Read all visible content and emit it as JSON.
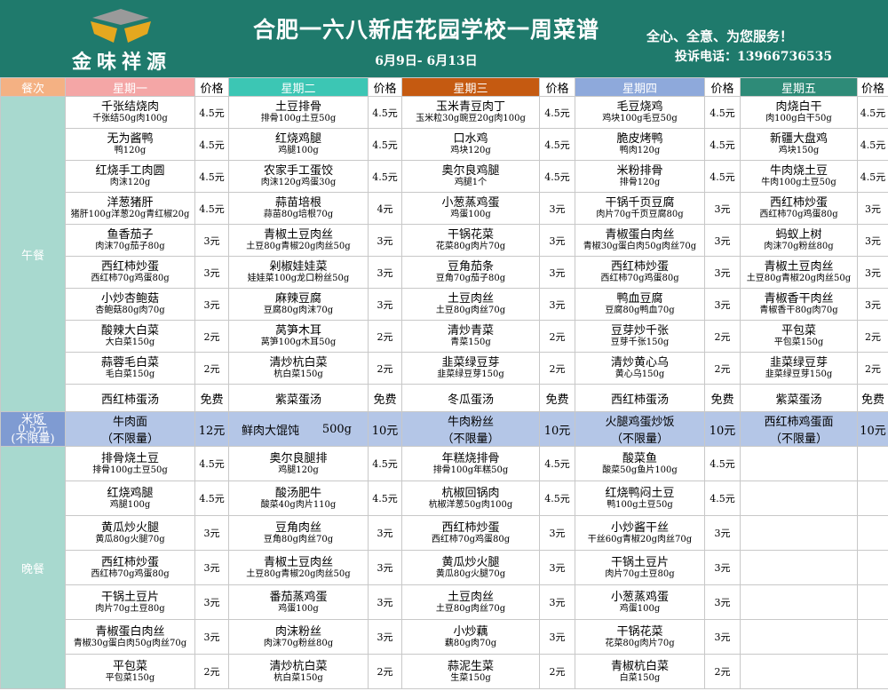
{
  "brand": {
    "name": "金味祥源"
  },
  "title": "合肥一六八新店花园学校一周菜谱",
  "date_range": "6月9日- 6月13日",
  "slogan": "全心、全意、为您服务！",
  "hotline": "投诉电话：13966736535",
  "colors": {
    "header_bg": "#1f7a6c",
    "logo_gold": "#e5a81f",
    "logo_grey": "#9a9a9a"
  },
  "columns": {
    "meal": "餐次",
    "price": "价格",
    "days": [
      "星期一",
      "星期二",
      "星期三",
      "星期四",
      "星期五"
    ]
  },
  "meals": {
    "lunch": "午餐",
    "rice": "米饭\n0.5元\n(不限量)",
    "dinner": "晚餐"
  },
  "lunch_rows": [
    [
      {
        "n": "千张结烧肉",
        "d": "千张结50g肉100g",
        "p": "4.5元"
      },
      {
        "n": "土豆排骨",
        "d": "排骨100g土豆50g",
        "p": "4.5元"
      },
      {
        "n": "玉米青豆肉丁",
        "d": "玉米粒30g豌豆20g肉100g",
        "p": "4.5元"
      },
      {
        "n": "毛豆烧鸡",
        "d": "鸡块100g毛豆50g",
        "p": "4.5元"
      },
      {
        "n": "肉烧白干",
        "d": "肉100g白干50g",
        "p": "4.5元"
      }
    ],
    [
      {
        "n": "无为酱鸭",
        "d": "鸭120g",
        "p": "4.5元"
      },
      {
        "n": "红烧鸡腿",
        "d": "鸡腿100g",
        "p": "4.5元"
      },
      {
        "n": "口水鸡",
        "d": "鸡块120g",
        "p": "4.5元"
      },
      {
        "n": "脆皮烤鸭",
        "d": "鸭肉120g",
        "p": "4.5元"
      },
      {
        "n": "新疆大盘鸡",
        "d": "鸡块150g",
        "p": "4.5元"
      }
    ],
    [
      {
        "n": "红烧手工肉圆",
        "d": "肉沫120g",
        "p": "4.5元"
      },
      {
        "n": "农家手工蛋饺",
        "d": "肉沫120g鸡蛋30g",
        "p": "4.5元"
      },
      {
        "n": "奥尔良鸡腿",
        "d": "鸡腿1个",
        "p": "4.5元"
      },
      {
        "n": "米粉排骨",
        "d": "排骨120g",
        "p": "4.5元"
      },
      {
        "n": "牛肉烧土豆",
        "d": "牛肉100g土豆50g",
        "p": "4.5元"
      }
    ],
    [
      {
        "n": "洋葱猪肝",
        "d": "猪肝100g洋葱20g青红椒20g",
        "p": "4.5元"
      },
      {
        "n": "蒜苗培根",
        "d": "蒜苗80g培根70g",
        "p": "4元"
      },
      {
        "n": "小葱蒸鸡蛋",
        "d": "鸡蛋100g",
        "p": "3元"
      },
      {
        "n": "干锅千页豆腐",
        "d": "肉片70g千页豆腐80g",
        "p": "3元"
      },
      {
        "n": "西红柿炒蛋",
        "d": "西红柿70g鸡蛋80g",
        "p": "3元"
      }
    ],
    [
      {
        "n": "鱼香茄子",
        "d": "肉沫70g茄子80g",
        "p": "3元"
      },
      {
        "n": "青椒土豆肉丝",
        "d": "土豆80g青椒20g肉丝50g",
        "p": "3元"
      },
      {
        "n": "干锅花菜",
        "d": "花菜80g肉片70g",
        "p": "3元"
      },
      {
        "n": "青椒蛋白肉丝",
        "d": "青椒30g蛋白肉50g肉丝70g",
        "p": "3元"
      },
      {
        "n": "蚂蚁上树",
        "d": "肉沫70g粉丝80g",
        "p": "3元"
      }
    ],
    [
      {
        "n": "西红柿炒蛋",
        "d": "西红柿70g鸡蛋80g",
        "p": "3元"
      },
      {
        "n": "剁椒娃娃菜",
        "d": "娃娃菜100g龙口粉丝50g",
        "p": "3元"
      },
      {
        "n": "豆角茄条",
        "d": "豆角70g茄子80g",
        "p": "3元"
      },
      {
        "n": "西红柿炒蛋",
        "d": "西红柿70g鸡蛋80g",
        "p": "3元"
      },
      {
        "n": "青椒土豆肉丝",
        "d": "土豆80g青椒20g肉丝50g",
        "p": "3元"
      }
    ],
    [
      {
        "n": "小炒杏鲍菇",
        "d": "杏鲍菇80g肉70g",
        "p": "3元"
      },
      {
        "n": "麻辣豆腐",
        "d": "豆腐80g肉沫70g",
        "p": "3元"
      },
      {
        "n": "土豆肉丝",
        "d": "土豆80g肉丝70g",
        "p": "3元"
      },
      {
        "n": "鸭血豆腐",
        "d": "豆腐80g鸭血70g",
        "p": "3元"
      },
      {
        "n": "青椒香干肉丝",
        "d": "青椒香干80g肉70g",
        "p": "3元"
      }
    ],
    [
      {
        "n": "酸辣大白菜",
        "d": "大白菜150g",
        "p": "2元"
      },
      {
        "n": "莴笋木耳",
        "d": "莴笋100g木耳50g",
        "p": "2元"
      },
      {
        "n": "清炒青菜",
        "d": "青菜150g",
        "p": "2元"
      },
      {
        "n": "豆芽炒千张",
        "d": "豆芽千张150g",
        "p": "2元"
      },
      {
        "n": "平包菜",
        "d": "平包菜150g",
        "p": "2元"
      }
    ],
    [
      {
        "n": "蒜蓉毛白菜",
        "d": "毛白菜150g",
        "p": "2元"
      },
      {
        "n": "清炒杭白菜",
        "d": "杭白菜150g",
        "p": "2元"
      },
      {
        "n": "韭菜绿豆芽",
        "d": "韭菜绿豆芽150g",
        "p": "2元"
      },
      {
        "n": "清炒黄心乌",
        "d": "黄心乌150g",
        "p": "2元"
      },
      {
        "n": "韭菜绿豆芽",
        "d": "韭菜绿豆芽150g",
        "p": "2元"
      }
    ]
  ],
  "soup_row": [
    {
      "n": "西红柿蛋汤",
      "p": "免费"
    },
    {
      "n": "紫菜蛋汤",
      "p": "免费"
    },
    {
      "n": "冬瓜蛋汤",
      "p": "免费"
    },
    {
      "n": "西红柿蛋汤",
      "p": "免费"
    },
    {
      "n": "紫菜蛋汤",
      "p": "免费"
    }
  ],
  "rice_row": [
    {
      "n": "牛肉面",
      "sub": "（不限量）",
      "p": "12元"
    },
    {
      "n": "鲜肉大馄饨",
      "extra": "500g",
      "p": "10元"
    },
    {
      "n": "牛肉粉丝",
      "sub": "（不限量）",
      "p": "10元"
    },
    {
      "n": "火腿鸡蛋炒饭",
      "sub": "（不限量）",
      "p": "10元"
    },
    {
      "n": "西红柿鸡蛋面",
      "sub": "（不限量）",
      "p": "10元"
    }
  ],
  "dinner_rows": [
    [
      {
        "n": "排骨烧土豆",
        "d": "排骨100g土豆50g",
        "p": "4.5元"
      },
      {
        "n": "奥尔良腿排",
        "d": "鸡腿120g",
        "p": "4.5元"
      },
      {
        "n": "年糕烧排骨",
        "d": "排骨100g年糕50g",
        "p": "4.5元"
      },
      {
        "n": "酸菜鱼",
        "d": "酸菜50g鱼片100g",
        "p": "4.5元"
      }
    ],
    [
      {
        "n": "红烧鸡腿",
        "d": "鸡腿100g",
        "p": "4.5元"
      },
      {
        "n": "酸汤肥牛",
        "d": "酸菜40g肉片110g",
        "p": "4.5元"
      },
      {
        "n": "杭椒回锅肉",
        "d": "杭椒洋葱50g肉100g",
        "p": "4.5元"
      },
      {
        "n": "红烧鸭闷土豆",
        "d": "鸭100g土豆50g",
        "p": "4.5元"
      }
    ],
    [
      {
        "n": "黄瓜炒火腿",
        "d": "黄瓜80g火腿70g",
        "p": "3元"
      },
      {
        "n": "豆角肉丝",
        "d": "豆角80g肉丝70g",
        "p": "3元"
      },
      {
        "n": "西红柿炒蛋",
        "d": "西红柿70g鸡蛋80g",
        "p": "3元"
      },
      {
        "n": "小炒酱干丝",
        "d": "干丝60g青椒20g肉丝70g",
        "p": "3元"
      }
    ],
    [
      {
        "n": "西红柿炒蛋",
        "d": "西红柿70g鸡蛋80g",
        "p": "3元"
      },
      {
        "n": "青椒土豆肉丝",
        "d": "土豆80g青椒20g肉丝50g",
        "p": "3元"
      },
      {
        "n": "黄瓜炒火腿",
        "d": "黄瓜80g火腿70g",
        "p": "3元"
      },
      {
        "n": "干锅土豆片",
        "d": "肉片70g土豆80g",
        "p": "3元"
      }
    ],
    [
      {
        "n": "干锅土豆片",
        "d": "肉片70g土豆80g",
        "p": "3元"
      },
      {
        "n": "番茄蒸鸡蛋",
        "d": "鸡蛋100g",
        "p": "3元"
      },
      {
        "n": "土豆肉丝",
        "d": "土豆80g肉丝70g",
        "p": "3元"
      },
      {
        "n": "小葱蒸鸡蛋",
        "d": "鸡蛋100g",
        "p": "3元"
      }
    ],
    [
      {
        "n": "青椒蛋白肉丝",
        "d": "青椒30g蛋白肉50g肉丝70g",
        "p": "3元"
      },
      {
        "n": "肉沫粉丝",
        "d": "肉沫70g粉丝80g",
        "p": "3元"
      },
      {
        "n": "小炒藕",
        "d": "藕80g肉70g",
        "p": "3元"
      },
      {
        "n": "干锅花菜",
        "d": "花菜80g肉片70g",
        "p": "3元"
      }
    ],
    [
      {
        "n": "平包菜",
        "d": "平包菜150g",
        "p": "2元"
      },
      {
        "n": "清炒杭白菜",
        "d": "杭白菜150g",
        "p": "2元"
      },
      {
        "n": "蒜泥生菜",
        "d": "生菜150g",
        "p": "2元"
      },
      {
        "n": "青椒杭白菜",
        "d": "白菜150g",
        "p": "2元"
      }
    ]
  ]
}
